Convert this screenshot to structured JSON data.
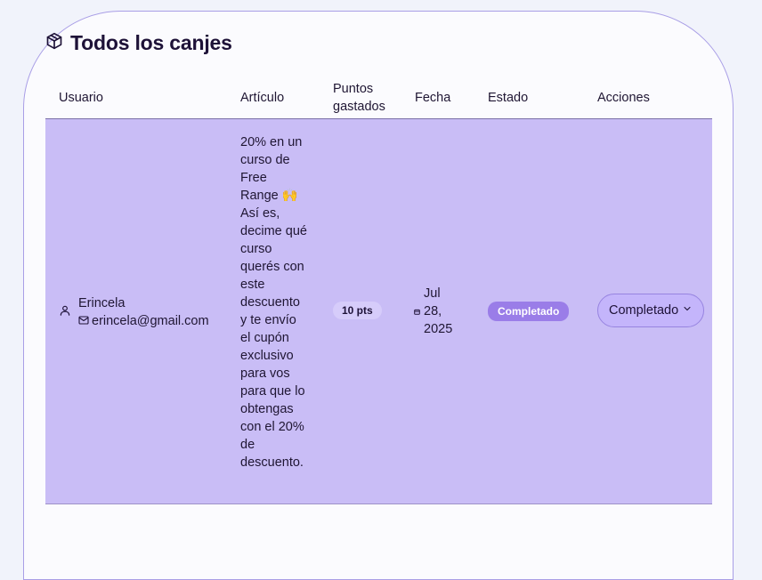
{
  "section": {
    "title": "Todos los canjes",
    "icon": "package-icon"
  },
  "table": {
    "headers": [
      "Usuario",
      "Artículo",
      "Puntos gastados",
      "Fecha",
      "Estado",
      "Acciones"
    ],
    "rows": [
      {
        "user_name": "Erincela",
        "user_email": "erincela@gmail.com",
        "article": "20% en un curso de Free Range 🙌 Así es, decime qué curso querés con este descuento y te envío el cupón exclusivo para vos para que lo obtengas con el 20% de descuento.",
        "points": "10 pts",
        "date": "Jul 28, 2025",
        "status": "Completado",
        "action_value": "Completado"
      }
    ]
  },
  "colors": {
    "row_highlight": "#c9bdf6",
    "badge": "#9a7de8",
    "card_border": "#a99ee6"
  }
}
